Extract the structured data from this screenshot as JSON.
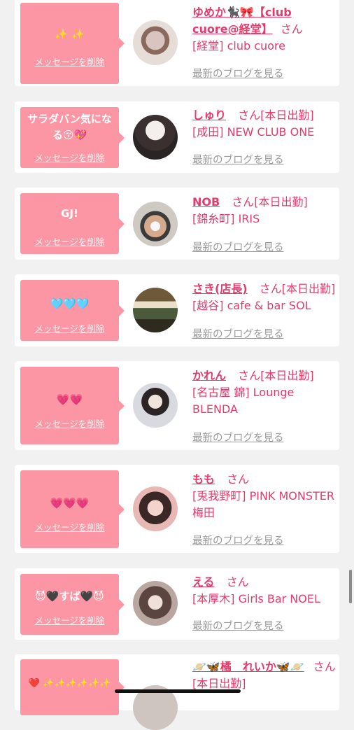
{
  "delete_label": "メッセージを削除",
  "blog_label": "最新のブログを見る",
  "honorific": "さん",
  "colors": {
    "accent": "#e63a6b",
    "bubble": "#fc96a4",
    "muted": "#9a9a9a",
    "background": "#f1f1f1"
  },
  "cards": [
    {
      "message": "✨ ✨",
      "name": "ゆめか🐈‍⬛🎀【club cuore@経堂】",
      "tag": "",
      "shop": "[経堂] club cuore"
    },
    {
      "message": "サラダバン気になる😚💖",
      "name": "しゅり",
      "tag": "[本日出勤]",
      "shop": "[成田] NEW CLUB ONE"
    },
    {
      "message": "GJ!",
      "name": "NOB",
      "tag": "[本日出勤]",
      "shop": "[錦糸町] IRIS"
    },
    {
      "message": "🩵🩵🩵",
      "name": "さき(店長)",
      "tag": "[本日出勤]",
      "shop": "[越谷] cafe & bar SOL"
    },
    {
      "message": "💗💗",
      "name": "かれん",
      "tag": "[本日出勤]",
      "shop": "[名古屋 錦] Lounge BLENDA"
    },
    {
      "message": "💗💗💗",
      "name": "もも",
      "tag": "",
      "shop": "[兎我野町] PINK MONSTER梅田"
    },
    {
      "message": "😈🖤すば🖤😈",
      "name": "える",
      "tag": "",
      "shop": "[本厚木] Girls Bar NOEL"
    },
    {
      "message": "❤️ ✨✨✨✨✨✨",
      "name": "🪐🦋橘　れいか🦋🪐",
      "tag": "[本日出勤]",
      "shop": ""
    }
  ]
}
